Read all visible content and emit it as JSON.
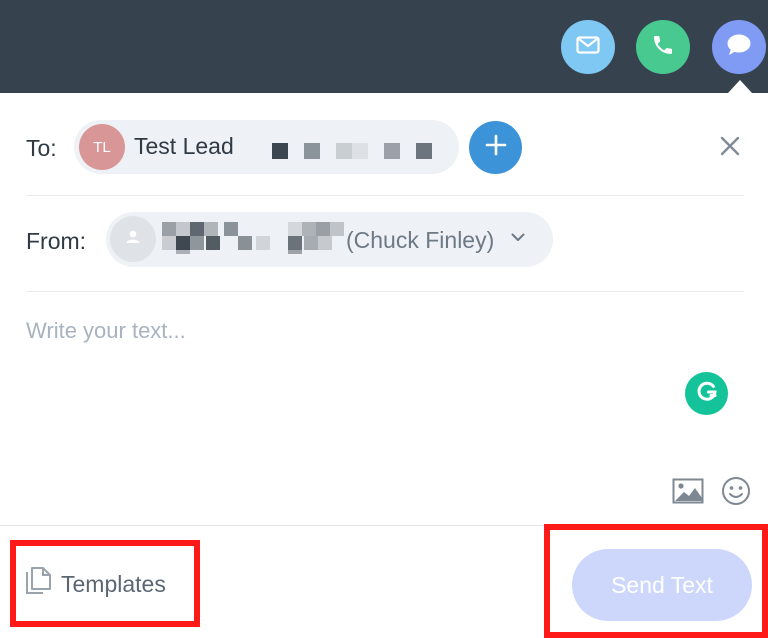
{
  "header": {
    "channels": [
      {
        "name": "email",
        "icon": "envelope-icon",
        "color": "#7ec8f3"
      },
      {
        "name": "call",
        "icon": "phone-icon",
        "color": "#47c98f"
      },
      {
        "name": "text",
        "icon": "chat-bubble-icon",
        "color": "#7f9bf3",
        "selected": true
      }
    ],
    "background": "#36434f"
  },
  "to": {
    "label": "To:",
    "recipient": {
      "initials": "TL",
      "name": "Test Lead",
      "avatar_color": "#d99696"
    },
    "add_icon": "plus-icon",
    "close_icon": "close-icon"
  },
  "from": {
    "label": "From:",
    "sender_name": "(Chuck Finley)",
    "avatar_icon": "person-icon",
    "dropdown_icon": "chevron-down-icon"
  },
  "message": {
    "placeholder": "Write your text...",
    "value": ""
  },
  "tools": {
    "grammarly_icon": "grammarly-icon",
    "image_icon": "image-icon",
    "emoji_icon": "smiley-icon"
  },
  "footer": {
    "templates_label": "Templates",
    "templates_icon": "document-copy-icon",
    "send_label": "Send Text",
    "send_color": "#cdd7fc",
    "highlight_color": "#ff1a1a"
  }
}
